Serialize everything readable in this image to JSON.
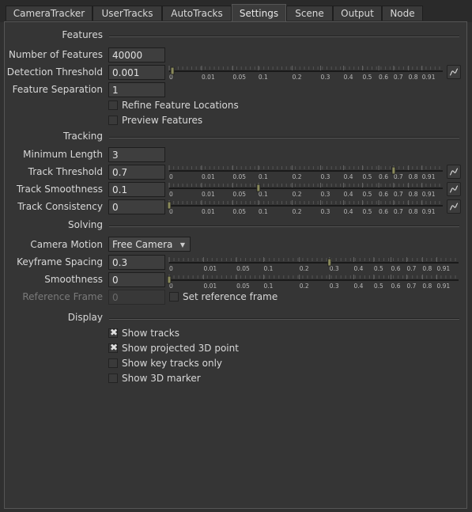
{
  "tabs": [
    {
      "label": "CameraTracker",
      "active": false
    },
    {
      "label": "UserTracks",
      "active": false
    },
    {
      "label": "AutoTracks",
      "active": false
    },
    {
      "label": "Settings",
      "active": true
    },
    {
      "label": "Scene",
      "active": false
    },
    {
      "label": "Output",
      "active": false
    },
    {
      "label": "Node",
      "active": false
    }
  ],
  "sections": {
    "features": "Features",
    "tracking": "Tracking",
    "solving": "Solving",
    "display": "Display"
  },
  "features": {
    "number_label": "Number of Features",
    "number_value": "40000",
    "detection_label": "Detection Threshold",
    "detection_value": "0.001",
    "separation_label": "Feature Separation",
    "separation_value": "1",
    "refine_label": "Refine Feature Locations",
    "refine_checked": false,
    "preview_label": "Preview Features",
    "preview_checked": false
  },
  "tracking": {
    "min_length_label": "Minimum Length",
    "min_length_value": "3",
    "threshold_label": "Track Threshold",
    "threshold_value": "0.7",
    "smoothness_label": "Track Smoothness",
    "smoothness_value": "0.1",
    "consistency_label": "Track Consistency",
    "consistency_value": "0"
  },
  "solving": {
    "camera_motion_label": "Camera Motion",
    "camera_motion_value": "Free Camera",
    "keyframe_label": "Keyframe Spacing",
    "keyframe_value": "0.3",
    "smoothness_label": "Smoothness",
    "smoothness_value": "0",
    "ref_frame_label": "Reference Frame",
    "ref_frame_value": "0",
    "set_ref_label": "Set reference frame",
    "set_ref_checked": false
  },
  "display": {
    "show_tracks_label": "Show tracks",
    "show_tracks_checked": true,
    "show_projected_label": "Show projected 3D point",
    "show_projected_checked": true,
    "show_key_label": "Show key tracks only",
    "show_key_checked": false,
    "show_marker_label": "Show 3D marker",
    "show_marker_checked": false
  },
  "slider_ticks": {
    "type_a": [
      "0",
      "0.01",
      "0.05",
      "0.1",
      "0.2",
      "0.3",
      "0.4",
      "0.5",
      "0.6",
      "0.7",
      "0.8",
      "0.91"
    ],
    "type_b": [
      "0",
      "0.01",
      "0.05",
      "0.1",
      "0.2",
      "0.3",
      "0.4",
      "0.5",
      "0.6",
      "0.7",
      "0.8",
      "0.91"
    ]
  },
  "sliders": {
    "detection": 0.001,
    "track_threshold": 0.7,
    "track_smoothness": 0.1,
    "track_consistency": 0,
    "keyframe_spacing": 0.3,
    "smoothness": 0
  },
  "colors": {
    "background": "#303030",
    "panel": "#353535",
    "field": "#3e3e3e",
    "slider_handle": "#8a8a5a",
    "checkmark": "#e0e0e0"
  },
  "icons": {
    "curve": "curve-editor-icon",
    "check": "checkmark-icon",
    "dropdown": "chevron-down-icon"
  }
}
